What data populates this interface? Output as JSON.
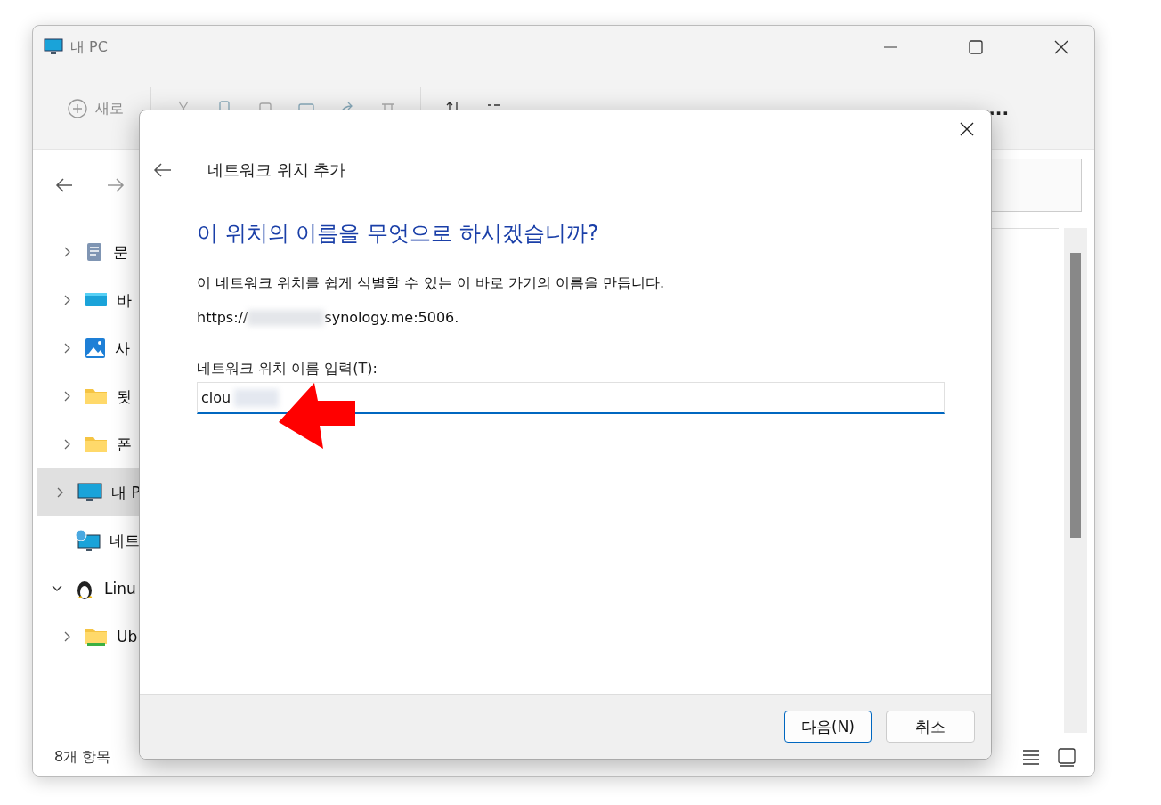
{
  "window": {
    "title": "내 PC"
  },
  "toolbar": {
    "new_button": "새로",
    "more_button": "..."
  },
  "sidebar": {
    "items": [
      {
        "label": "문",
        "kind": "document",
        "expanded": false,
        "selected": false
      },
      {
        "label": "바",
        "kind": "desktop",
        "expanded": false,
        "selected": false
      },
      {
        "label": "사",
        "kind": "pictures",
        "expanded": false,
        "selected": false
      },
      {
        "label": "됫",
        "kind": "folder",
        "expanded": false,
        "selected": false
      },
      {
        "label": "폰",
        "kind": "folder",
        "expanded": false,
        "selected": false
      },
      {
        "label": "내 P",
        "kind": "pc",
        "expanded": false,
        "selected": true
      },
      {
        "label": "네트",
        "kind": "network",
        "selected": false
      },
      {
        "label": "Linu",
        "kind": "linux",
        "expanded": true,
        "selected": false
      },
      {
        "label": "Ub",
        "kind": "drive",
        "expanded": false,
        "selected": false
      }
    ]
  },
  "status_bar": {
    "count": "8개 항목"
  },
  "dialog": {
    "title": "네트워크 위치 추가",
    "heading": "이 위치의 이름을 무엇으로 하시겠습니까?",
    "description": "이 네트워크 위치를 쉽게 식별할 수 있는 이 바로 가기의 이름을 만듭니다.",
    "url_prefix": "https://",
    "url_suffix": "synology.me:5006.",
    "field_label": "네트워크 위치 이름 입력(T):",
    "field_value": "clou",
    "buttons": [
      {
        "label": "다음(N)",
        "kind": "primary"
      },
      {
        "label": "취소",
        "kind": "secondary"
      }
    ]
  }
}
